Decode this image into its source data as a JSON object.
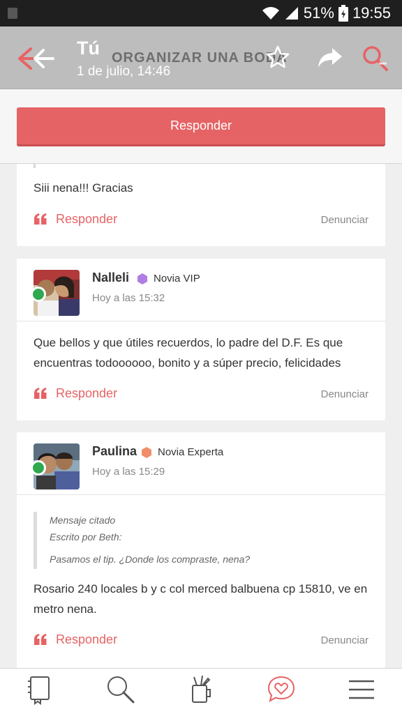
{
  "status_bar": {
    "battery_percent": "51%",
    "time": "19:55"
  },
  "header": {
    "title": "Tú",
    "subtitle": "1 de julio, 14:46",
    "topic": "ORGANIZAR UNA BODA"
  },
  "reply_bar": {
    "button_label": "Responder"
  },
  "posts": [
    {
      "text": "Siii nena!!! Gracias",
      "reply_label": "Responder",
      "report_label": "Denunciar"
    },
    {
      "author": "Nalleli",
      "badge": "Novia VIP",
      "badge_color": "#b07ee0",
      "time": "Hoy a las 15:32",
      "text": "Que bellos y que útiles recuerdos, lo padre del D.F. Es que encuentras todoooooo, bonito y a súper precio, felicidades",
      "reply_label": "Responder",
      "report_label": "Denunciar"
    },
    {
      "author": "Paulina",
      "badge": "Novia Experta",
      "badge_color": "#f08e6b",
      "time": "Hoy a las 15:29",
      "quote": {
        "heading": "Mensaje citado",
        "by": "Escrito por Beth:",
        "text": "Pasamos el tip. ¿Donde los compraste, nena?"
      },
      "text": "Rosario 240 locales b y c col merced balbuena cp 15810, ve en metro nena.",
      "reply_label": "Responder",
      "report_label": "Denunciar"
    }
  ],
  "colors": {
    "accent": "#e66365",
    "online": "#2fa84f",
    "header_bg": "#bdbdbd"
  },
  "bottom_nav": {
    "active_index": 3,
    "items": [
      {
        "icon": "checklist-book-icon"
      },
      {
        "icon": "search-icon"
      },
      {
        "icon": "inspiration-icon"
      },
      {
        "icon": "community-heart-icon"
      },
      {
        "icon": "menu-icon"
      }
    ]
  }
}
